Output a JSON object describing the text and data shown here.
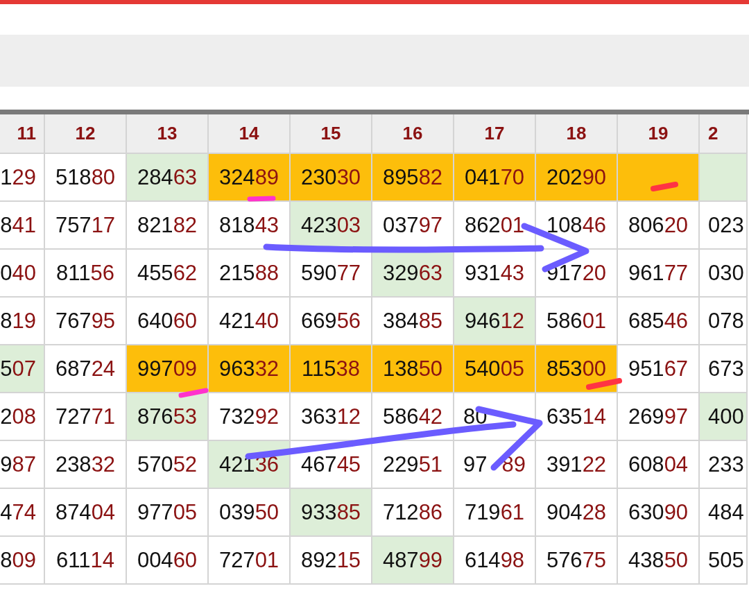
{
  "table": {
    "columns": [
      {
        "label": "11"
      },
      {
        "label": "12"
      },
      {
        "label": "13"
      },
      {
        "label": "14"
      },
      {
        "label": "15"
      },
      {
        "label": "16"
      },
      {
        "label": "17"
      },
      {
        "label": "18"
      },
      {
        "label": "19"
      },
      {
        "label": "2"
      }
    ],
    "rows": [
      [
        {
          "head": "1",
          "tail": "29",
          "highlighted": false,
          "tinted": false
        },
        {
          "head": "518",
          "tail": "80",
          "highlighted": false,
          "tinted": false
        },
        {
          "head": "284",
          "tail": "63",
          "highlighted": false,
          "tinted": true
        },
        {
          "head": "324",
          "tail": "89",
          "highlighted": true,
          "tinted": false
        },
        {
          "head": "230",
          "tail": "30",
          "highlighted": true,
          "tinted": false
        },
        {
          "head": "895",
          "tail": "82",
          "highlighted": true,
          "tinted": false
        },
        {
          "head": "041",
          "tail": "70",
          "highlighted": true,
          "tinted": false
        },
        {
          "head": "202",
          "tail": "90",
          "highlighted": true,
          "tinted": false
        },
        {
          "highlighted": true,
          "tinted": false
        },
        {
          "highlighted": false,
          "tinted": true
        }
      ],
      [
        {
          "head": "8",
          "tail": "41",
          "highlighted": false,
          "tinted": false
        },
        {
          "head": "757",
          "tail": "17",
          "highlighted": false,
          "tinted": false
        },
        {
          "head": "821",
          "tail": "82",
          "highlighted": false,
          "tinted": false
        },
        {
          "head": "818",
          "tail": "43",
          "highlighted": false,
          "tinted": false
        },
        {
          "head": "423",
          "tail": "03",
          "highlighted": false,
          "tinted": true
        },
        {
          "head": "037",
          "tail": "97",
          "highlighted": false,
          "tinted": false
        },
        {
          "head": "862",
          "tail": "01",
          "highlighted": false,
          "tinted": false
        },
        {
          "head": "108",
          "tail": "46",
          "highlighted": false,
          "tinted": false
        },
        {
          "head": "806",
          "tail": "20",
          "highlighted": false,
          "tinted": false
        },
        {
          "head": "023",
          "highlighted": false,
          "tinted": false
        }
      ],
      [
        {
          "head": "0",
          "tail": "40",
          "highlighted": false,
          "tinted": false
        },
        {
          "head": "811",
          "tail": "56",
          "highlighted": false,
          "tinted": false
        },
        {
          "head": "455",
          "tail": "62",
          "highlighted": false,
          "tinted": false
        },
        {
          "head": "215",
          "tail": "88",
          "highlighted": false,
          "tinted": false
        },
        {
          "head": "590",
          "tail": "77",
          "highlighted": false,
          "tinted": false
        },
        {
          "head": "329",
          "tail": "63",
          "highlighted": false,
          "tinted": true
        },
        {
          "head": "931",
          "tail": "43",
          "highlighted": false,
          "tinted": false
        },
        {
          "head": "917",
          "tail": "20",
          "highlighted": false,
          "tinted": false
        },
        {
          "head": "961",
          "tail": "77",
          "highlighted": false,
          "tinted": false
        },
        {
          "head": "030",
          "highlighted": false,
          "tinted": false
        }
      ],
      [
        {
          "head": "8",
          "tail": "19",
          "highlighted": false,
          "tinted": false
        },
        {
          "head": "767",
          "tail": "95",
          "highlighted": false,
          "tinted": false
        },
        {
          "head": "640",
          "tail": "60",
          "highlighted": false,
          "tinted": false
        },
        {
          "head": "421",
          "tail": "40",
          "highlighted": false,
          "tinted": false
        },
        {
          "head": "669",
          "tail": "56",
          "highlighted": false,
          "tinted": false
        },
        {
          "head": "384",
          "tail": "85",
          "highlighted": false,
          "tinted": false
        },
        {
          "head": "946",
          "tail": "12",
          "highlighted": false,
          "tinted": true
        },
        {
          "head": "586",
          "tail": "01",
          "highlighted": false,
          "tinted": false
        },
        {
          "head": "685",
          "tail": "46",
          "highlighted": false,
          "tinted": false
        },
        {
          "head": "078",
          "highlighted": false,
          "tinted": false
        }
      ],
      [
        {
          "head": "5",
          "tail": "07",
          "highlighted": false,
          "tinted": true
        },
        {
          "head": "687",
          "tail": "24",
          "highlighted": false,
          "tinted": false
        },
        {
          "head": "997",
          "tail": "09",
          "highlighted": true,
          "tinted": false
        },
        {
          "head": "963",
          "tail": "32",
          "highlighted": true,
          "tinted": false
        },
        {
          "head": "115",
          "tail": "38",
          "highlighted": true,
          "tinted": false
        },
        {
          "head": "138",
          "tail": "50",
          "highlighted": true,
          "tinted": false
        },
        {
          "head": "540",
          "tail": "05",
          "highlighted": true,
          "tinted": false
        },
        {
          "head": "853",
          "tail": "00",
          "highlighted": true,
          "tinted": false
        },
        {
          "head": "951",
          "tail": "67",
          "highlighted": false,
          "tinted": false
        },
        {
          "head": "673",
          "highlighted": false,
          "tinted": false
        }
      ],
      [
        {
          "head": "2",
          "tail": "08",
          "highlighted": false,
          "tinted": false
        },
        {
          "head": "727",
          "tail": "71",
          "highlighted": false,
          "tinted": false
        },
        {
          "head": "876",
          "tail": "53",
          "highlighted": false,
          "tinted": true
        },
        {
          "head": "732",
          "tail": "92",
          "highlighted": false,
          "tinted": false
        },
        {
          "head": "363",
          "tail": "12",
          "highlighted": false,
          "tinted": false
        },
        {
          "head": "586",
          "tail": "42",
          "highlighted": false,
          "tinted": false
        },
        {
          "head": "80",
          "highlighted": false,
          "tinted": false
        },
        {
          "head": "635",
          "tail": "14",
          "highlighted": false,
          "tinted": false
        },
        {
          "head": "269",
          "tail": "97",
          "highlighted": false,
          "tinted": false
        },
        {
          "head": "400",
          "highlighted": false,
          "tinted": true
        }
      ],
      [
        {
          "head": "9",
          "tail": "87",
          "highlighted": false,
          "tinted": false
        },
        {
          "head": "238",
          "tail": "32",
          "highlighted": false,
          "tinted": false
        },
        {
          "head": "570",
          "tail": "52",
          "highlighted": false,
          "tinted": false
        },
        {
          "head": "421",
          "tail": "36",
          "highlighted": false,
          "tinted": true
        },
        {
          "head": "467",
          "tail": "45",
          "highlighted": false,
          "tinted": false
        },
        {
          "head": "229",
          "tail": "51",
          "highlighted": false,
          "tinted": false
        },
        {
          "head": "97",
          "tail": "89",
          "highlighted": false,
          "tinted": false
        },
        {
          "head": "391",
          "tail": "22",
          "highlighted": false,
          "tinted": false
        },
        {
          "head": "608",
          "tail": "04",
          "highlighted": false,
          "tinted": false
        },
        {
          "head": "233",
          "highlighted": false,
          "tinted": false
        }
      ],
      [
        {
          "head": "4",
          "tail": "74",
          "highlighted": false,
          "tinted": false
        },
        {
          "head": "874",
          "tail": "04",
          "highlighted": false,
          "tinted": false
        },
        {
          "head": "977",
          "tail": "05",
          "highlighted": false,
          "tinted": false
        },
        {
          "head": "039",
          "tail": "50",
          "highlighted": false,
          "tinted": false
        },
        {
          "head": "933",
          "tail": "85",
          "highlighted": false,
          "tinted": true
        },
        {
          "head": "712",
          "tail": "86",
          "highlighted": false,
          "tinted": false
        },
        {
          "head": "719",
          "tail": "61",
          "highlighted": false,
          "tinted": false
        },
        {
          "head": "904",
          "tail": "28",
          "highlighted": false,
          "tinted": false
        },
        {
          "head": "630",
          "tail": "90",
          "highlighted": false,
          "tinted": false
        },
        {
          "head": "484",
          "highlighted": false,
          "tinted": false
        }
      ],
      [
        {
          "head": "8",
          "tail": "09",
          "highlighted": false,
          "tinted": false
        },
        {
          "head": "611",
          "tail": "14",
          "highlighted": false,
          "tinted": false
        },
        {
          "head": "004",
          "tail": "60",
          "highlighted": false,
          "tinted": false
        },
        {
          "head": "727",
          "tail": "01",
          "highlighted": false,
          "tinted": false
        },
        {
          "head": "892",
          "tail": "15",
          "highlighted": false,
          "tinted": false
        },
        {
          "head": "487",
          "tail": "99",
          "highlighted": false,
          "tinted": true
        },
        {
          "head": "614",
          "tail": "98",
          "highlighted": false,
          "tinted": false
        },
        {
          "head": "576",
          "tail": "75",
          "highlighted": false,
          "tinted": false
        },
        {
          "head": "438",
          "tail": "50",
          "highlighted": false,
          "tinted": false
        },
        {
          "head": "505",
          "highlighted": false,
          "tinted": false
        }
      ]
    ]
  }
}
